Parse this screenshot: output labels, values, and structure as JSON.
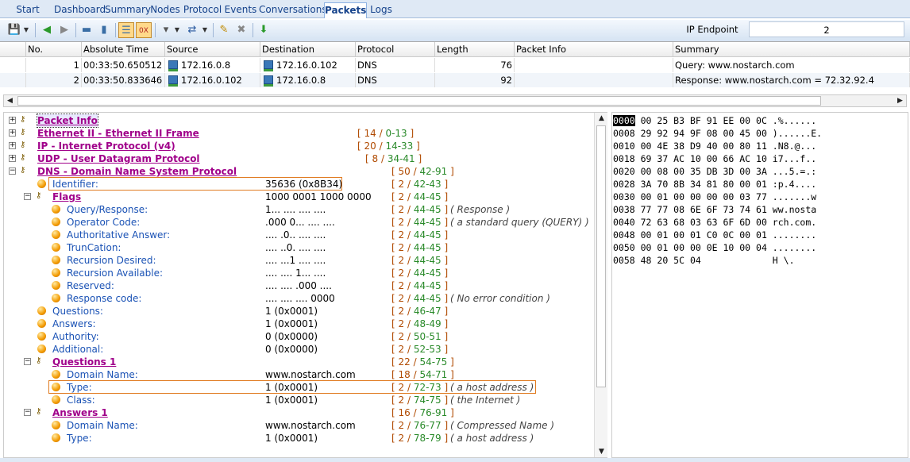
{
  "tabs": [
    "Start Page",
    "Dashboard",
    "Summary",
    "Nodes",
    "Protocol",
    "Events",
    "Conversations",
    "Packets",
    "Logs"
  ],
  "active_tab": "Packets",
  "ip_endpoint": {
    "label": "IP Endpoint",
    "value": "2"
  },
  "columns": [
    "No.",
    "Absolute Time",
    "Source",
    "Destination",
    "Protocol",
    "Length",
    "Packet Info",
    "Summary"
  ],
  "packets": [
    {
      "no": "1",
      "time": "00:33:50.650512",
      "src": "172.16.0.8",
      "dst": "172.16.0.102",
      "proto": "DNS",
      "len": "76",
      "info": "",
      "summary": "Query: www.nostarch.com"
    },
    {
      "no": "2",
      "time": "00:33:50.833646",
      "src": "172.16.0.102",
      "dst": "172.16.0.8",
      "proto": "DNS",
      "len": "92",
      "info": "",
      "summary": "Response: www.nostarch.com = 72.32.92.4"
    }
  ],
  "tree": [
    {
      "kind": "sec",
      "label": "Packet Info",
      "range": ""
    },
    {
      "kind": "sec",
      "label": "Ethernet II - Ethernet II Frame",
      "len": "14",
      "rng": "0-13"
    },
    {
      "kind": "sec",
      "label": "IP - Internet Protocol (v4)",
      "len": "20",
      "rng": "14-33"
    },
    {
      "kind": "sec",
      "label": "UDP - User Datagram Protocol",
      "len": "8",
      "rng": "34-41"
    },
    {
      "kind": "sec",
      "label": "DNS - Domain Name System Protocol",
      "len": "50",
      "rng": "42-91"
    },
    {
      "kind": "fld",
      "label": "Identifier:",
      "value": "35636 (0x8B34)",
      "len": "2",
      "rng": "42-43",
      "comment": ""
    },
    {
      "kind": "sub",
      "label": "Flags",
      "value": "1000 0001 1000 0000",
      "len": "2",
      "rng": "44-45"
    },
    {
      "kind": "fld2",
      "label": "Query/Response:",
      "value": "1... .... .... ....",
      "len": "2",
      "rng": "44-45",
      "comment": "Response"
    },
    {
      "kind": "fld2",
      "label": "Operator Code:",
      "value": ".000 0... .... ....",
      "len": "2",
      "rng": "44-45",
      "comment": "a standard query (QUERY)"
    },
    {
      "kind": "fld2",
      "label": "Authoritative Answer:",
      "value": ".... .0.. .... ....",
      "len": "2",
      "rng": "44-45",
      "comment": ""
    },
    {
      "kind": "fld2",
      "label": "TrunCation:",
      "value": ".... ..0. .... ....",
      "len": "2",
      "rng": "44-45",
      "comment": ""
    },
    {
      "kind": "fld2",
      "label": "Recursion Desired:",
      "value": ".... ...1 .... ....",
      "len": "2",
      "rng": "44-45",
      "comment": ""
    },
    {
      "kind": "fld2",
      "label": "Recursion Available:",
      "value": ".... .... 1... ....",
      "len": "2",
      "rng": "44-45",
      "comment": ""
    },
    {
      "kind": "fld2",
      "label": "Reserved:",
      "value": ".... .... .000 ....",
      "len": "2",
      "rng": "44-45",
      "comment": ""
    },
    {
      "kind": "fld2",
      "label": "Response code:",
      "value": ".... .... .... 0000",
      "len": "2",
      "rng": "44-45",
      "comment": "No error condition"
    },
    {
      "kind": "fld",
      "label": "Questions:",
      "value": "1 (0x0001)",
      "len": "2",
      "rng": "46-47",
      "comment": ""
    },
    {
      "kind": "fld",
      "label": "Answers:",
      "value": "1 (0x0001)",
      "len": "2",
      "rng": "48-49",
      "comment": ""
    },
    {
      "kind": "fld",
      "label": "Authority:",
      "value": "0 (0x0000)",
      "len": "2",
      "rng": "50-51",
      "comment": ""
    },
    {
      "kind": "fld",
      "label": "Additional:",
      "value": "0 (0x0000)",
      "len": "2",
      "rng": "52-53",
      "comment": ""
    },
    {
      "kind": "sub",
      "label": "Questions 1",
      "value": "",
      "len": "22",
      "rng": "54-75"
    },
    {
      "kind": "fld2",
      "label": "Domain Name:",
      "value": "www.nostarch.com",
      "len": "18",
      "rng": "54-71",
      "comment": ""
    },
    {
      "kind": "fld2",
      "label": "Type:",
      "value": "1 (0x0001)",
      "len": "2",
      "rng": "72-73",
      "comment": "a host address"
    },
    {
      "kind": "fld2",
      "label": "Class:",
      "value": "1 (0x0001)",
      "len": "2",
      "rng": "74-75",
      "comment": "the Internet"
    },
    {
      "kind": "sub",
      "label": "Answers 1",
      "value": "",
      "len": "16",
      "rng": "76-91"
    },
    {
      "kind": "fld2",
      "label": "Domain Name:",
      "value": "www.nostarch.com",
      "len": "2",
      "rng": "76-77",
      "comment": "Compressed Name"
    },
    {
      "kind": "fld2",
      "label": "Type:",
      "value": "1 (0x0001)",
      "len": "2",
      "rng": "78-79",
      "comment": "a host address"
    }
  ],
  "hex": [
    {
      "off": "0000",
      "bytes": "00 25 B3 BF 91 EE 00 0C",
      "ascii": ".%......"
    },
    {
      "off": "0008",
      "bytes": "29 92 94 9F 08 00 45 00",
      "ascii": ")......E."
    },
    {
      "off": "0010",
      "bytes": "00 4E 38 D9 40 00 80 11",
      "ascii": ".N8.@..."
    },
    {
      "off": "0018",
      "bytes": "69 37 AC 10 00 66 AC 10",
      "ascii": "i7...f.."
    },
    {
      "off": "0020",
      "bytes": "00 08 00 35 DB 3D 00 3A",
      "ascii": "...5.=.:"
    },
    {
      "off": "0028",
      "bytes": "3A 70 8B 34 81 80 00 01",
      "ascii": ":p.4...."
    },
    {
      "off": "0030",
      "bytes": "00 01 00 00 00 00 03 77",
      "ascii": ".......w"
    },
    {
      "off": "0038",
      "bytes": "77 77 08 6E 6F 73 74 61",
      "ascii": "ww.nosta"
    },
    {
      "off": "0040",
      "bytes": "72 63 68 03 63 6F 6D 00",
      "ascii": "rch.com."
    },
    {
      "off": "0048",
      "bytes": "00 01 00 01 C0 0C 00 01",
      "ascii": "........"
    },
    {
      "off": "0050",
      "bytes": "00 01 00 00 0E 10 00 04",
      "ascii": "........"
    },
    {
      "off": "0058",
      "bytes": "48 20 5C 04            ",
      "ascii": "H \\."
    }
  ]
}
